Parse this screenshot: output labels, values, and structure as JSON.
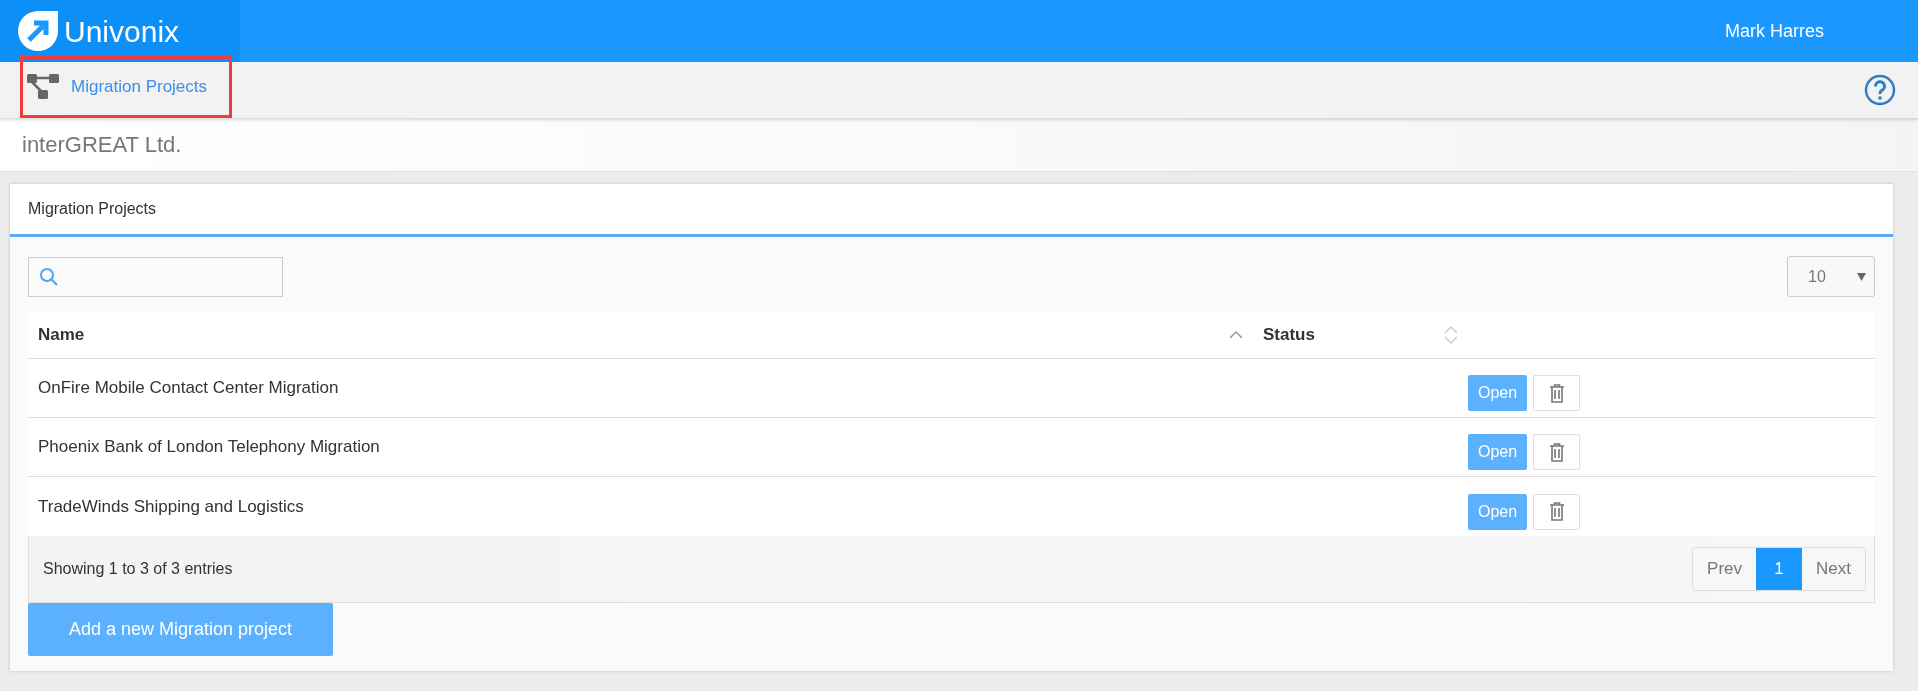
{
  "header": {
    "logo_text": "Univonix",
    "user": "Mark Harres"
  },
  "breadcrumb": {
    "label": "Migration Projects",
    "highlighted": true
  },
  "company": "interGREAT Ltd.",
  "panel": {
    "title": "Migration Projects",
    "page_size": "10",
    "table": {
      "columns": [
        {
          "label": "Name",
          "sorted": true
        },
        {
          "label": "Status",
          "sorted": false
        }
      ],
      "rows": [
        {
          "name": "OnFire Mobile Contact Center Migration",
          "open": "Open"
        },
        {
          "name": "Phoenix Bank of London Telephony Migration",
          "open": "Open"
        },
        {
          "name": "TradeWinds Shipping and Logistics",
          "open": "Open"
        }
      ]
    },
    "info": "Showing 1 to 3 of 3 entries",
    "pagination": {
      "prev": "Prev",
      "pages": [
        {
          "label": "1",
          "selected": true
        }
      ],
      "next": "Next"
    },
    "add_button": "Add a new Migration project"
  }
}
